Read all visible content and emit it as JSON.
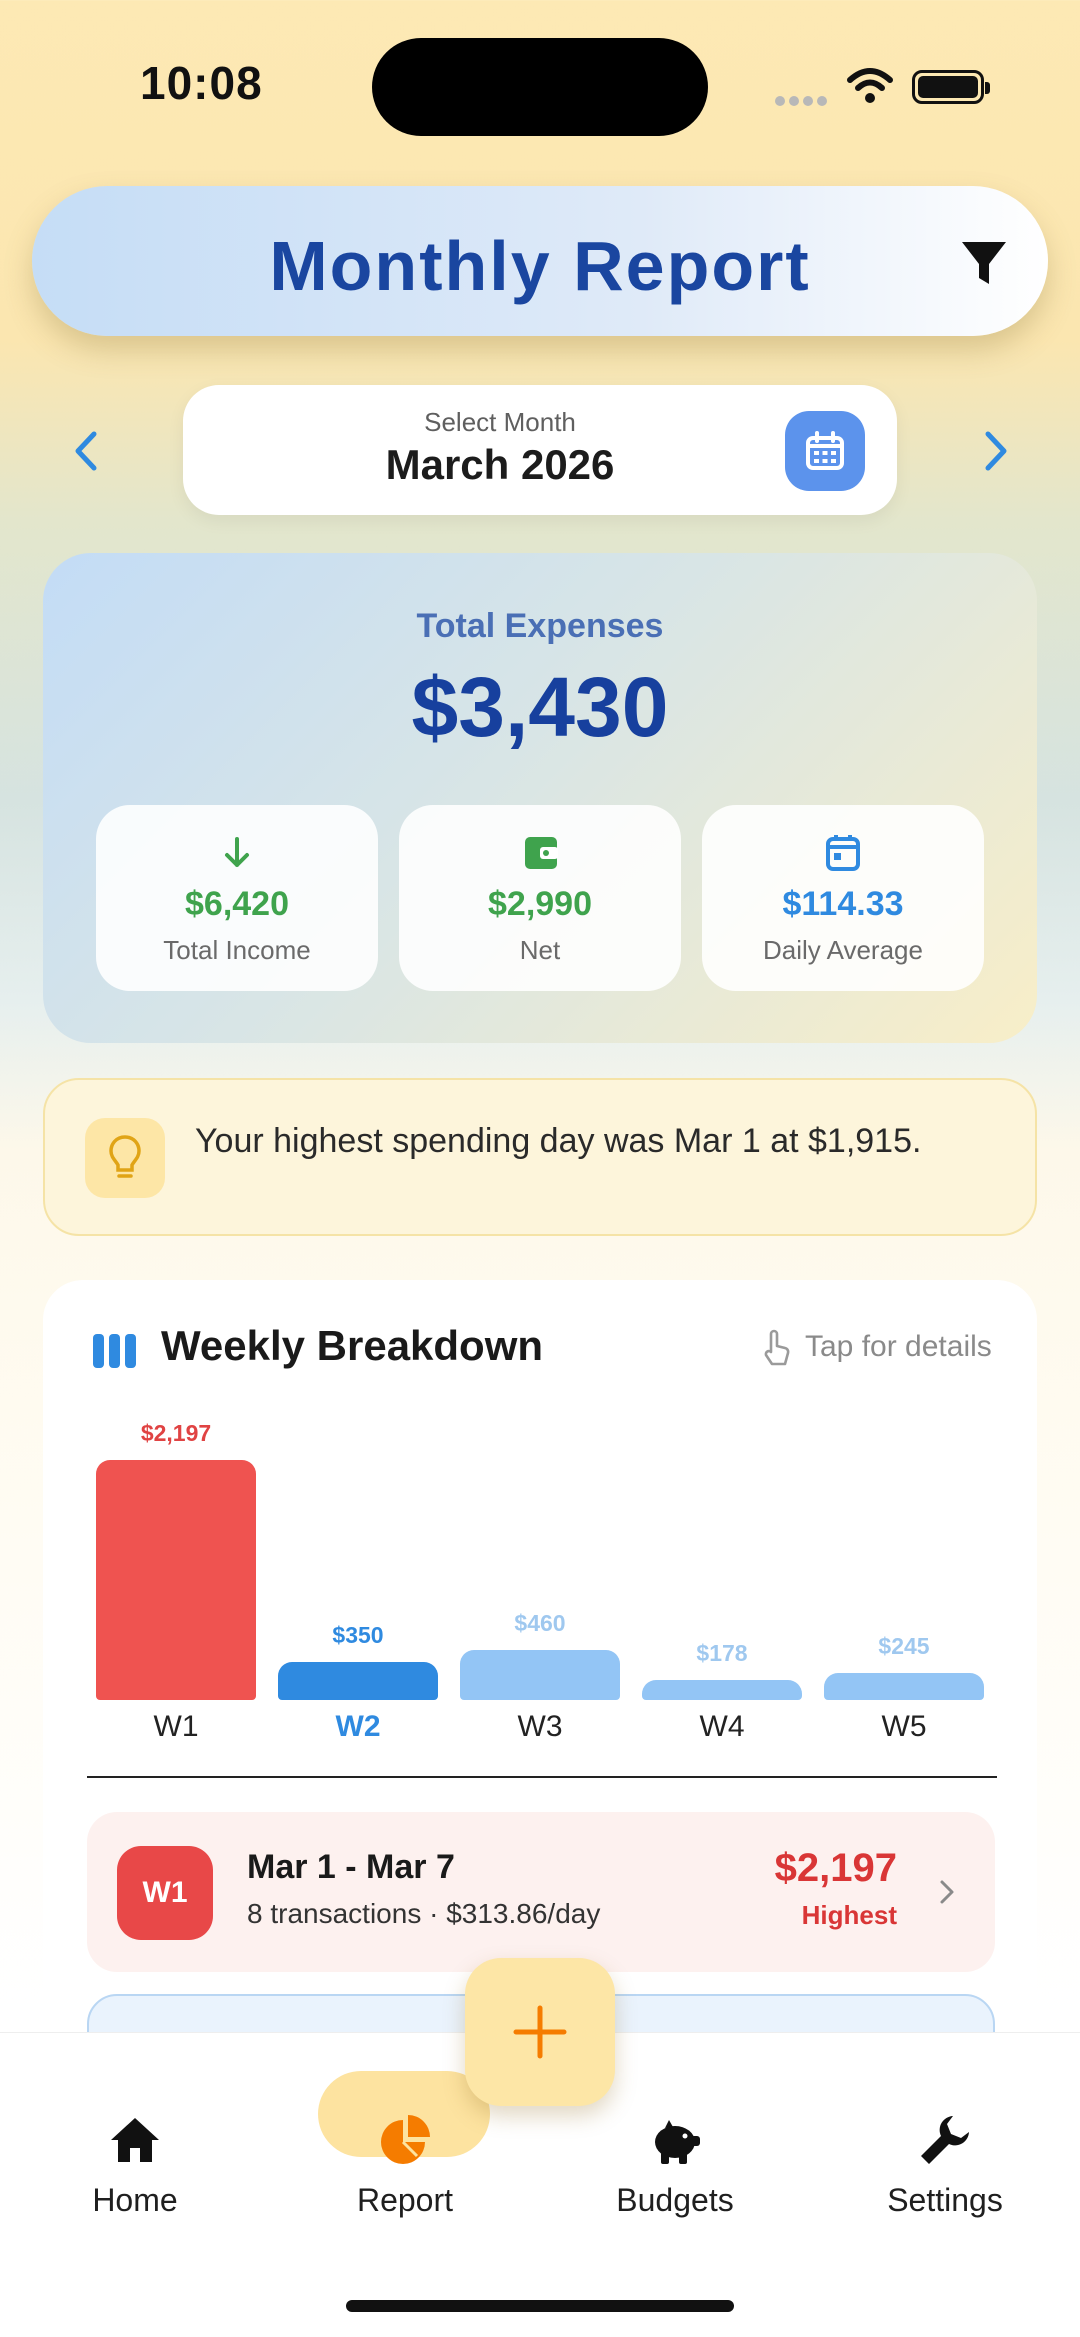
{
  "status_bar": {
    "time": "10:08"
  },
  "header": {
    "title": "Monthly Report"
  },
  "month_selector": {
    "caption": "Select Month",
    "value": "March 2026"
  },
  "summary": {
    "label": "Total Expenses",
    "total": "$3,430",
    "stats": [
      {
        "value": "$6,420",
        "label": "Total Income",
        "color": "#3fa34d",
        "icon": "arrow-down-icon"
      },
      {
        "value": "$2,990",
        "label": "Net",
        "color": "#3fa34d",
        "icon": "wallet-icon"
      },
      {
        "value": "$114.33",
        "label": "Daily Average",
        "color": "#2f8ae0",
        "icon": "calendar-icon"
      }
    ]
  },
  "insight": {
    "text": "Your highest spending day was Mar 1 at $1,915."
  },
  "weekly": {
    "title": "Weekly Breakdown",
    "hint": "Tap for details",
    "rows": [
      {
        "badge": "W1",
        "range": "Mar 1 - Mar 7",
        "meta": "8 transactions  ·  $313.86/day",
        "amount": "$2,197",
        "flag": "Highest"
      }
    ]
  },
  "chart_data": {
    "type": "bar",
    "categories": [
      "W1",
      "W2",
      "W3",
      "W4",
      "W5"
    ],
    "values": [
      2197,
      350,
      460,
      178,
      245
    ],
    "value_labels": [
      "$2,197",
      "$350",
      "$460",
      "$178",
      "$245"
    ],
    "selected": "W2",
    "colors": {
      "highest": "#ef5350",
      "selected": "#2f8ae0",
      "default": "#93c5f5",
      "label_highest": "#e04343",
      "label_selected": "#2f8ae0",
      "label_default": "#9fc8ef"
    }
  },
  "tabbar": {
    "items": [
      {
        "label": "Home",
        "icon": "home-icon"
      },
      {
        "label": "Report",
        "icon": "pie-chart-icon",
        "active": true
      },
      {
        "label": "Budgets",
        "icon": "piggy-bank-icon"
      },
      {
        "label": "Settings",
        "icon": "wrench-icon"
      }
    ],
    "fab_icon": "plus-icon",
    "accent": "#f57c00"
  }
}
